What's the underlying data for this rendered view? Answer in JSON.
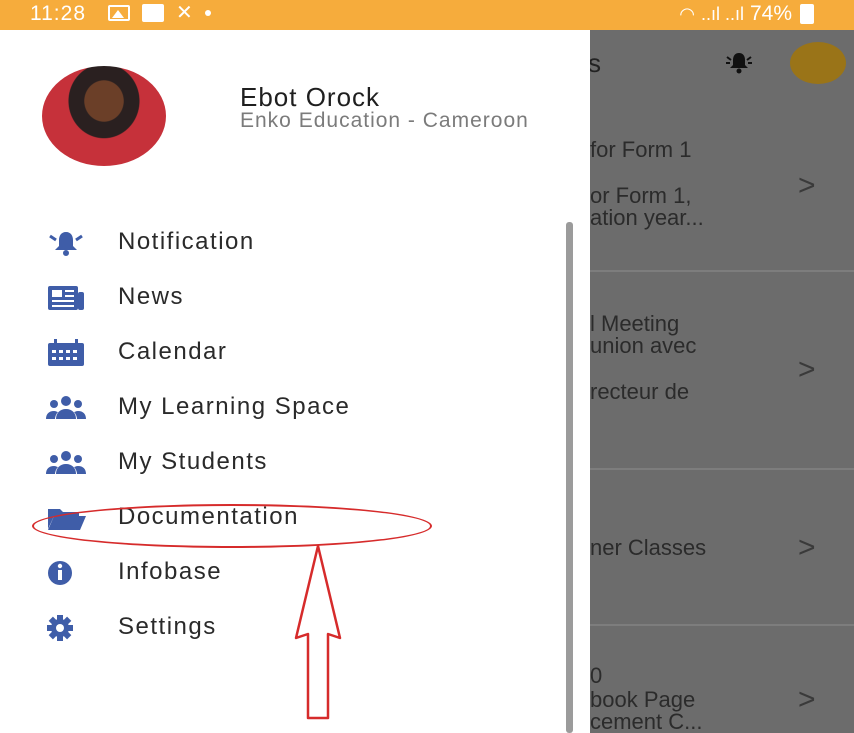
{
  "status_bar": {
    "time": "11:28",
    "battery": "74%",
    "signal_text": "..ıl ..ıl"
  },
  "profile": {
    "name": "Ebot Orock",
    "organization": "Enko Education - Cameroon"
  },
  "menu": [
    {
      "label": "Notification",
      "icon": "bell-icon"
    },
    {
      "label": "News",
      "icon": "newspaper-icon"
    },
    {
      "label": "Calendar",
      "icon": "calendar-icon"
    },
    {
      "label": "My Learning Space",
      "icon": "users-icon"
    },
    {
      "label": "My Students",
      "icon": "users-icon"
    },
    {
      "label": "Documentation",
      "icon": "folder-icon"
    },
    {
      "label": "Infobase",
      "icon": "info-icon"
    },
    {
      "label": "Settings",
      "icon": "gear-icon"
    }
  ],
  "background_list": {
    "header_char": "s",
    "items": [
      {
        "line1": "for Form 1",
        "line2": "or Form 1,",
        "line3": "ation year..."
      },
      {
        "line1": "l Meeting",
        "line2": "union avec",
        "line3": "recteur de"
      },
      {
        "line1": "ner Classes"
      },
      {
        "line1": "0",
        "line2": "book Page",
        "line3": "cement C..."
      }
    ],
    "chevron": ">"
  },
  "colors": {
    "status_bar": "#f6ac3c",
    "icon_blue": "#3f5da8",
    "highlight_red": "#d62b2b"
  }
}
